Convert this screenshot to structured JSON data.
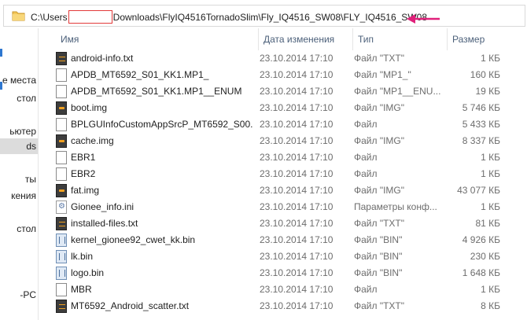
{
  "address_bar": {
    "path_prefix": "C:\\Users",
    "path_suffix": "Downloads\\FlyIQ4516TornadoSlim\\Fly_IQ4516_SW08\\FLY_IQ4516_SW08"
  },
  "sidebar": {
    "items": [
      {
        "label": "е места"
      },
      {
        "label": "стол"
      },
      {
        "label": "ьютер"
      },
      {
        "label": "ds",
        "selected": true
      },
      {
        "label": "ты"
      },
      {
        "label": "кения"
      },
      {
        "label": "стол"
      },
      {
        "label": "-PC"
      }
    ]
  },
  "columns": {
    "name": "Имя",
    "date": "Дата изменения",
    "type": "Тип",
    "size": "Размер"
  },
  "files": [
    {
      "name": "android-info.txt",
      "date": "23.10.2014 17:10",
      "type": "Файл \"TXT\"",
      "size": "1 КБ",
      "icon": "txt-file-icon"
    },
    {
      "name": "APDB_MT6592_S01_KK1.MP1_",
      "date": "23.10.2014 17:10",
      "type": "Файл \"MP1_\"",
      "size": "160 КБ",
      "icon": "document-icon"
    },
    {
      "name": "APDB_MT6592_S01_KK1.MP1__ENUM",
      "date": "23.10.2014 17:10",
      "type": "Файл \"MP1__ENU...",
      "size": "19 КБ",
      "icon": "document-icon"
    },
    {
      "name": "boot.img",
      "date": "23.10.2014 17:10",
      "type": "Файл \"IMG\"",
      "size": "5 746 КБ",
      "icon": "img-file-icon"
    },
    {
      "name": "BPLGUInfoCustomAppSrcP_MT6592_S00...",
      "date": "23.10.2014 17:10",
      "type": "Файл",
      "size": "5 433 КБ",
      "icon": "document-icon"
    },
    {
      "name": "cache.img",
      "date": "23.10.2014 17:10",
      "type": "Файл \"IMG\"",
      "size": "8 337 КБ",
      "icon": "img-file-icon"
    },
    {
      "name": "EBR1",
      "date": "23.10.2014 17:10",
      "type": "Файл",
      "size": "1 КБ",
      "icon": "document-icon"
    },
    {
      "name": "EBR2",
      "date": "23.10.2014 17:10",
      "type": "Файл",
      "size": "1 КБ",
      "icon": "document-icon"
    },
    {
      "name": "fat.img",
      "date": "23.10.2014 17:10",
      "type": "Файл \"IMG\"",
      "size": "43 077 КБ",
      "icon": "img-file-icon"
    },
    {
      "name": "Gionee_info.ini",
      "date": "23.10.2014 17:10",
      "type": "Параметры конф...",
      "size": "1 КБ",
      "icon": "settings-file-icon"
    },
    {
      "name": "installed-files.txt",
      "date": "23.10.2014 17:10",
      "type": "Файл \"TXT\"",
      "size": "81 КБ",
      "icon": "txt-file-icon"
    },
    {
      "name": "kernel_gionee92_cwet_kk.bin",
      "date": "23.10.2014 17:10",
      "type": "Файл \"BIN\"",
      "size": "4 926 КБ",
      "icon": "bin-file-icon"
    },
    {
      "name": "lk.bin",
      "date": "23.10.2014 17:10",
      "type": "Файл \"BIN\"",
      "size": "230 КБ",
      "icon": "bin-file-icon"
    },
    {
      "name": "logo.bin",
      "date": "23.10.2014 17:10",
      "type": "Файл \"BIN\"",
      "size": "1 648 КБ",
      "icon": "bin-file-icon"
    },
    {
      "name": "MBR",
      "date": "23.10.2014 17:10",
      "type": "Файл",
      "size": "1 КБ",
      "icon": "document-icon"
    },
    {
      "name": "MT6592_Android_scatter.txt",
      "date": "23.10.2014 17:10",
      "type": "Файл \"TXT\"",
      "size": "8 КБ",
      "icon": "txt-file-icon"
    }
  ],
  "colors": {
    "header_text": "#4c607a",
    "secondary_text": "#6d6d6d",
    "arrow": "#e0207a",
    "redaction_border": "#e23a3a"
  }
}
